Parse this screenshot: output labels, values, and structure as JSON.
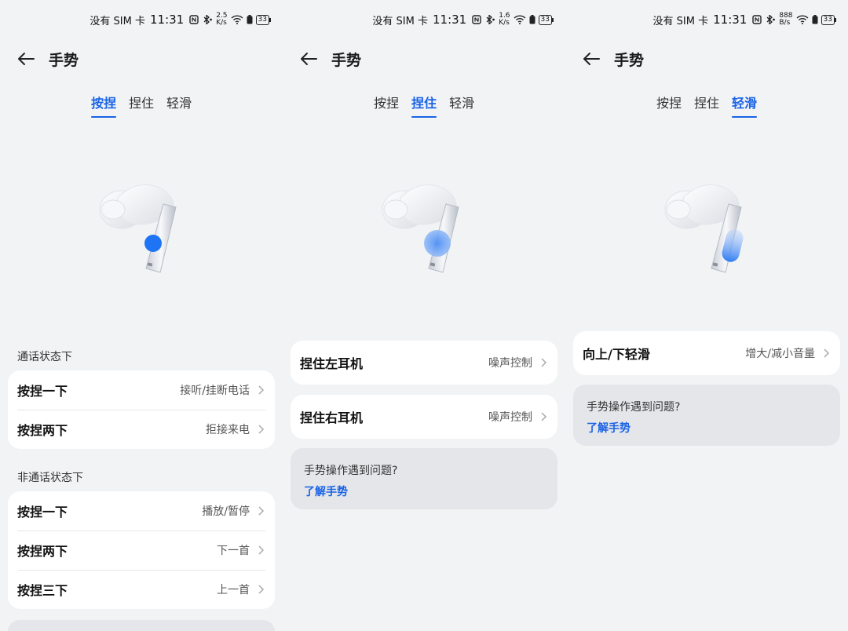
{
  "status": {
    "carrier": "没有 SIM 卡",
    "time": "11:31",
    "speed1": "2.5",
    "speed2": "1.6",
    "speed3": "888",
    "speed_unit": "K/s",
    "speed_unit3": "B/s",
    "battery": "33"
  },
  "header": {
    "title": "手势"
  },
  "tabs": [
    "按捏",
    "捏住",
    "轻滑"
  ],
  "screen1": {
    "active_tab": 0,
    "call_section": "通话状态下",
    "call_rows": [
      {
        "label": "按捏一下",
        "value": "接听/挂断电话"
      },
      {
        "label": "按捏两下",
        "value": "拒接来电"
      }
    ],
    "noncall_section": "非通话状态下",
    "noncall_rows": [
      {
        "label": "按捏一下",
        "value": "播放/暂停"
      },
      {
        "label": "按捏两下",
        "value": "下一首"
      },
      {
        "label": "按捏三下",
        "value": "上一首"
      }
    ]
  },
  "screen2": {
    "active_tab": 1,
    "rows": [
      {
        "label": "捏住左耳机",
        "value": "噪声控制"
      },
      {
        "label": "捏住右耳机",
        "value": "噪声控制"
      }
    ],
    "help_question": "手势操作遇到问题?",
    "help_link": "了解手势"
  },
  "screen3": {
    "active_tab": 2,
    "rows": [
      {
        "label": "向上/下轻滑",
        "value": "增大/减小音量"
      }
    ],
    "help_question": "手势操作遇到问题?",
    "help_link": "了解手势"
  },
  "colors": {
    "accent": "#1a63e6",
    "background": "#f1f3f5",
    "card": "#ffffff",
    "help_card": "#e4e6e9",
    "gesture_dot": "#1e74f5"
  },
  "icons": [
    "back-arrow-icon",
    "chevron-right-icon",
    "nfc-icon",
    "bluetooth-icon",
    "wifi-icon",
    "battery-icon",
    "earbud-icon"
  ]
}
